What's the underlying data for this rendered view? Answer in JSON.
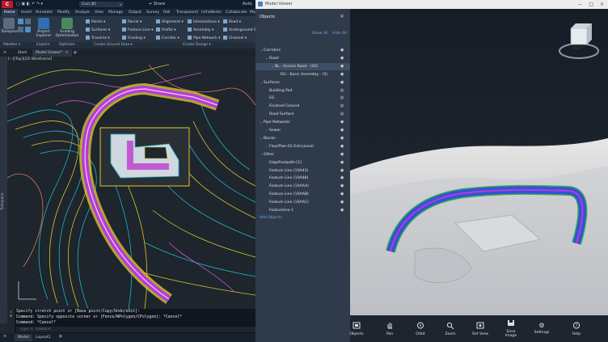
{
  "acad": {
    "app_search": "Civil 3D",
    "share": "Share",
    "title_trunc": "Auto",
    "workspace_label": "Toolspace",
    "menu_tabs": [
      "Home",
      "Insert",
      "Annotate",
      "Modify",
      "Analyze",
      "View",
      "Manage",
      "Output",
      "Survey",
      "Rail",
      "Transparent",
      "InfraWorks",
      "Collaborate",
      "Ma"
    ],
    "ribbon": {
      "toolspace": "Toolspace",
      "project_explorer": [
        "Project",
        "Explorer"
      ],
      "grading_optimization": [
        "Grading",
        "Optimization"
      ],
      "points": "Points",
      "surfaces": "Surfaces",
      "traverse": "Traverse",
      "parcel": "Parcel",
      "feature_line": "Feature Line",
      "grading": "Grading",
      "alignment": "Alignment",
      "profile": "Profile",
      "corridor": "Corridor",
      "intersections": "Intersections",
      "assembly": "Assembly",
      "pipe_network": "Pipe Network",
      "road": "Road",
      "underground": "Underground S",
      "channel": "Channel"
    },
    "panels": [
      "Palettes",
      "Explore",
      "Optimize",
      "Create Ground Data",
      "Create Design"
    ],
    "doc_tabs": [
      "Start",
      "Model Viewer*"
    ],
    "viewport_label": "[−][Top][2D Wireframe]",
    "side_label": "Toolspace",
    "cmd_lines": [
      "Specify stretch point or [Base point/Copy/Undo/eXit]:",
      "Command: Specify opposite corner or [Fence/WPolygon/CPolygon]: *Cancel*",
      "Command: *Cancel*"
    ],
    "cmd_placeholder": "Type a command",
    "layout_tabs": [
      "Model",
      "Layout1"
    ]
  },
  "mv": {
    "window_title": "Model Viewer",
    "panel_title": "Objects",
    "show_all": "Show All",
    "hide_all": "Hide All",
    "tree": [
      {
        "label": "Corridors",
        "indent": 0,
        "caret": "v",
        "eye": "visible"
      },
      {
        "label": "Road",
        "indent": 1,
        "caret": "v",
        "eye": "visible"
      },
      {
        "label": "BL - Access Road - (10)",
        "indent": 2,
        "caret": "v",
        "eye": "visible",
        "selected": true
      },
      {
        "label": "RG - Basic Assembly - (5)",
        "indent": 3,
        "caret": "",
        "eye": "visible"
      },
      {
        "label": "Surfaces",
        "indent": 0,
        "caret": "v",
        "eye": "visible"
      },
      {
        "label": "Building Pad",
        "indent": 1,
        "caret": "",
        "eye": "hidden"
      },
      {
        "label": "EG",
        "indent": 1,
        "caret": "",
        "eye": "hidden"
      },
      {
        "label": "Finished Ground",
        "indent": 1,
        "caret": "",
        "eye": "hidden"
      },
      {
        "label": "Road Surface",
        "indent": 1,
        "caret": "",
        "eye": "hidden"
      },
      {
        "label": "Pipe Networks",
        "indent": 0,
        "caret": "v",
        "eye": "visible"
      },
      {
        "label": "Sewer",
        "indent": 1,
        "caret": ">",
        "eye": "visible"
      },
      {
        "label": "Blocks",
        "indent": 0,
        "caret": "v",
        "eye": "visible"
      },
      {
        "label": "FloorPlan-01-EntryLevel",
        "indent": 1,
        "caret": ">",
        "eye": "visible"
      },
      {
        "label": "Other",
        "indent": 0,
        "caret": "v",
        "eye": "visible"
      },
      {
        "label": "EdgeFootpath-[1]",
        "indent": 1,
        "caret": "",
        "eye": "visible"
      },
      {
        "label": "Feature Line (10A43)",
        "indent": 1,
        "caret": "",
        "eye": "visible"
      },
      {
        "label": "Feature Line (10A48)",
        "indent": 1,
        "caret": "",
        "eye": "visible"
      },
      {
        "label": "Feature Line (10AAA)",
        "indent": 1,
        "caret": "",
        "eye": "visible"
      },
      {
        "label": "Feature Line (10AAB)",
        "indent": 1,
        "caret": "",
        "eye": "visible"
      },
      {
        "label": "Feature Line (10AAC)",
        "indent": 1,
        "caret": "",
        "eye": "visible"
      },
      {
        "label": "Featureline 1",
        "indent": 1,
        "caret": "",
        "eye": "visible"
      }
    ],
    "add_objects": "Add Objects",
    "viewcube_label": "RIGHT",
    "tools": [
      "Objects",
      "Pan",
      "Orbit",
      "Zoom",
      "Set View",
      [
        "Save",
        "Image"
      ],
      "Settings",
      "Help"
    ]
  },
  "colors": {
    "accent": "#3d82c8",
    "autocad_red": "#c3172f",
    "contour_cyan": "#1fb5c9",
    "contour_yellow": "#d7c832",
    "contour_magenta": "#c25bd2",
    "road_blue": "#3352d6",
    "road_magenta": "#b53bd9",
    "road_green": "#32a858"
  }
}
